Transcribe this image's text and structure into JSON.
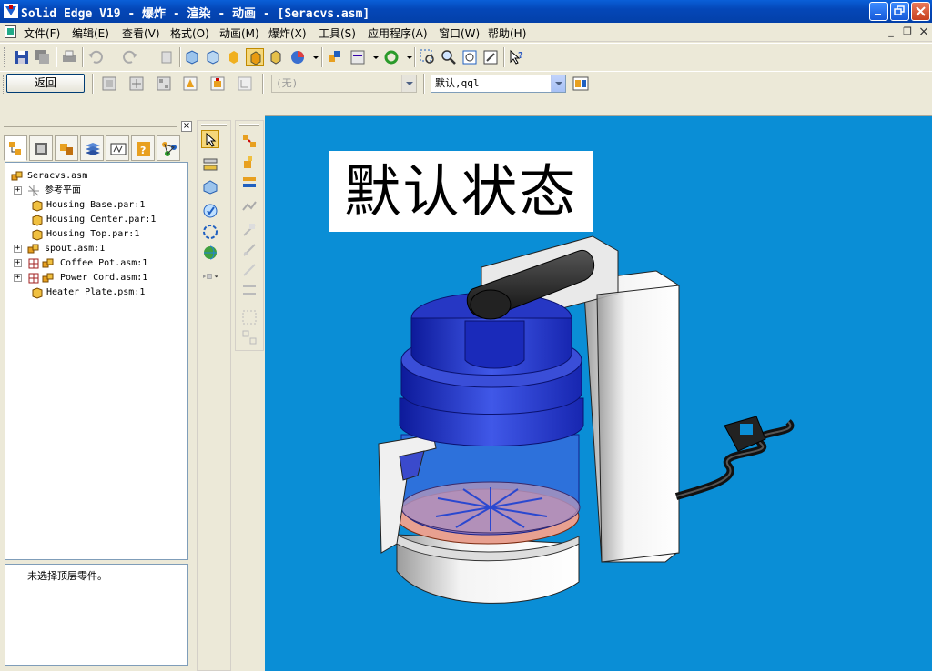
{
  "window": {
    "title": "Solid Edge V19 - 爆炸 - 渲染 - 动画 - [Seracvs.asm]",
    "minimize_icon": "minimize-icon",
    "restore_icon": "restore-icon",
    "close_icon": "close-icon"
  },
  "menu": {
    "items": [
      "文件(F)",
      "编辑(E)",
      "查看(V)",
      "格式(O)",
      "动画(M)",
      "爆炸(X)",
      "工具(S)",
      "应用程序(A)",
      "窗口(W)",
      "帮助(H)"
    ],
    "mdi_minimize": "_",
    "mdi_restore": "❐",
    "mdi_close": "×"
  },
  "toolbar2": {
    "back_label": "返回",
    "combo_none": "(无)",
    "combo_config": "默认,qql"
  },
  "left_pane": {
    "close": "×",
    "tabs": [
      "assembly-pathfinder",
      "parts-library",
      "feature-library",
      "layers",
      "sensors",
      "engineering-reference",
      "assembly-relationships"
    ],
    "tree": [
      {
        "label": "Seracvs.asm",
        "icon": "assembly-icon",
        "expander": ""
      },
      {
        "label": "参考平面",
        "icon": "reference-plane-icon",
        "expander": "+"
      },
      {
        "label": "Housing Base.par:1",
        "icon": "part-icon",
        "expander": ""
      },
      {
        "label": "Housing Center.par:1",
        "icon": "part-icon",
        "expander": ""
      },
      {
        "label": "Housing Top.par:1",
        "icon": "part-icon",
        "expander": ""
      },
      {
        "label": "spout.asm:1",
        "icon": "subassembly-icon",
        "expander": "+"
      },
      {
        "label": "Coffee Pot.asm:1",
        "icon": "subassembly-icon",
        "expander": "+"
      },
      {
        "label": "Power Cord.asm:1",
        "icon": "subassembly-icon",
        "expander": "+"
      },
      {
        "label": "Heater Plate.psm:1",
        "icon": "sheet-metal-icon",
        "expander": ""
      }
    ],
    "status": "未选择顶层零件。"
  },
  "viewport": {
    "state_label": "默认状态",
    "background": "#0a8ed6"
  }
}
